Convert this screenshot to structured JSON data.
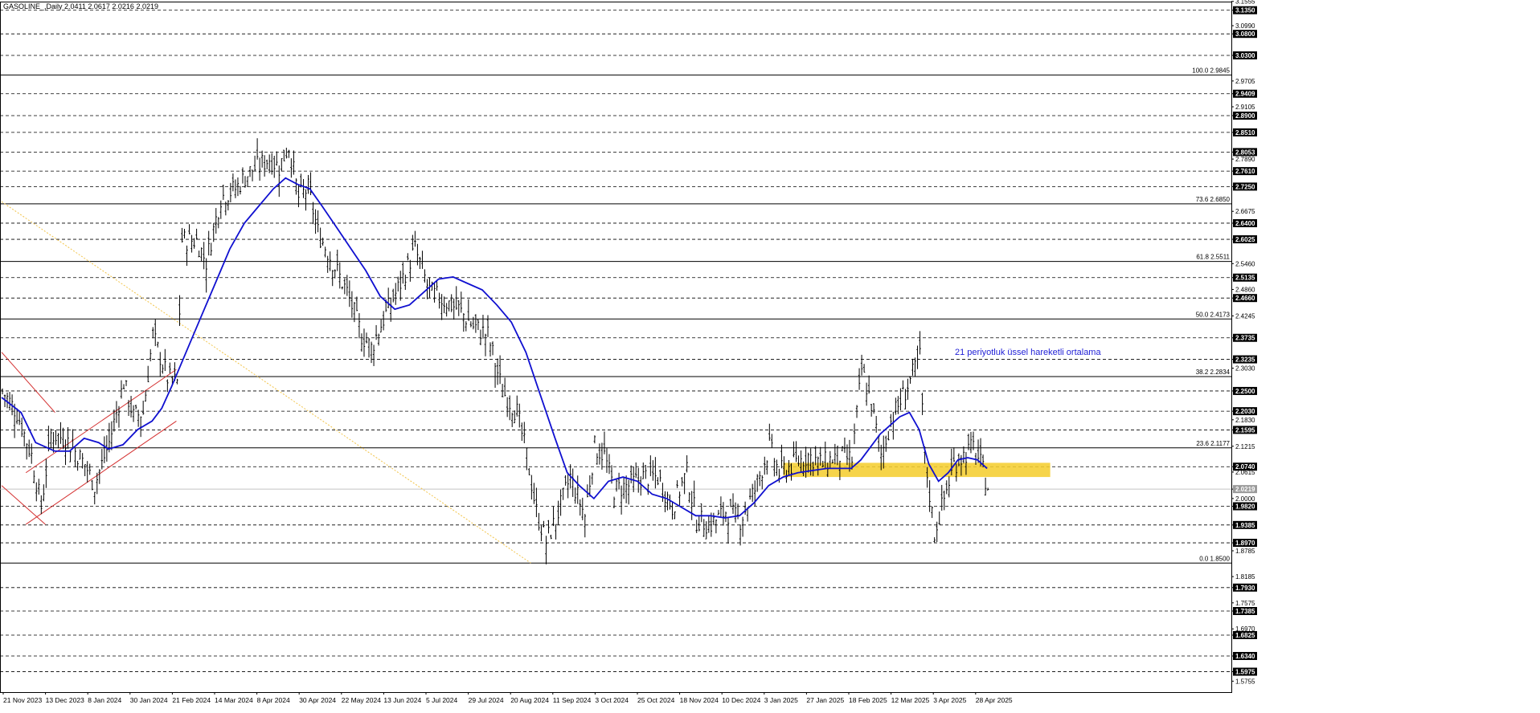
{
  "chart_data": {
    "type": "line",
    "title": "GASOLINE_,Daily  2.0411 2.0617 2.0216 2.0219",
    "ylim": [
      1.55,
      3.155
    ],
    "grid": true,
    "y_ticks": [
      {
        "v": 3.1555,
        "label": "3.1555",
        "box": false
      },
      {
        "v": 3.135,
        "label": "3.1350",
        "box": true
      },
      {
        "v": 3.099,
        "label": "3.0990",
        "box": false
      },
      {
        "v": 3.08,
        "label": "3.0800",
        "box": true
      },
      {
        "v": 3.03,
        "label": "3.0300",
        "box": true
      },
      {
        "v": 2.9705,
        "label": "2.9705",
        "box": false
      },
      {
        "v": 2.9409,
        "label": "2.9409",
        "box": true
      },
      {
        "v": 2.9105,
        "label": "2.9105",
        "box": false
      },
      {
        "v": 2.89,
        "label": "2.8900",
        "box": true
      },
      {
        "v": 2.851,
        "label": "2.8510",
        "box": true
      },
      {
        "v": 2.8053,
        "label": "2.8053",
        "box": true
      },
      {
        "v": 2.789,
        "label": "2.7890",
        "box": false
      },
      {
        "v": 2.761,
        "label": "2.7610",
        "box": true
      },
      {
        "v": 2.725,
        "label": "2.7250",
        "box": true
      },
      {
        "v": 2.6675,
        "label": "2.6675",
        "box": false
      },
      {
        "v": 2.64,
        "label": "2.6400",
        "box": true
      },
      {
        "v": 2.6025,
        "label": "2.6025",
        "box": true
      },
      {
        "v": 2.546,
        "label": "2.5460",
        "box": false
      },
      {
        "v": 2.5135,
        "label": "2.5135",
        "box": true
      },
      {
        "v": 2.486,
        "label": "2.4860",
        "box": false
      },
      {
        "v": 2.466,
        "label": "2.4660",
        "box": true
      },
      {
        "v": 2.4245,
        "label": "2.4245",
        "box": false
      },
      {
        "v": 2.3735,
        "label": "2.3735",
        "box": true
      },
      {
        "v": 2.3235,
        "label": "2.3235",
        "box": true
      },
      {
        "v": 2.303,
        "label": "2.3030",
        "box": false
      },
      {
        "v": 2.25,
        "label": "2.2500",
        "box": true
      },
      {
        "v": 2.203,
        "label": "2.2030",
        "box": true
      },
      {
        "v": 2.183,
        "label": "2.1830",
        "box": false
      },
      {
        "v": 2.1595,
        "label": "2.1595",
        "box": true
      },
      {
        "v": 2.1215,
        "label": "2.1215",
        "box": false
      },
      {
        "v": 2.074,
        "label": "2.0740",
        "box": true
      },
      {
        "v": 2.0615,
        "label": "2.0615",
        "box": false
      },
      {
        "v": 2.0219,
        "label": "2.0219",
        "box": "current"
      },
      {
        "v": 2.0,
        "label": "2.0000",
        "box": false
      },
      {
        "v": 1.982,
        "label": "1.9820",
        "box": true
      },
      {
        "v": 1.9385,
        "label": "1.9385",
        "box": true
      },
      {
        "v": 1.897,
        "label": "1.8970",
        "box": true
      },
      {
        "v": 1.8785,
        "label": "1.8785",
        "box": false
      },
      {
        "v": 1.8185,
        "label": "1.8185",
        "box": false
      },
      {
        "v": 1.793,
        "label": "1.7930",
        "box": true
      },
      {
        "v": 1.7575,
        "label": "1.7575",
        "box": false
      },
      {
        "v": 1.7385,
        "label": "1.7385",
        "box": true
      },
      {
        "v": 1.697,
        "label": "1.6970",
        "box": false
      },
      {
        "v": 1.6825,
        "label": "1.6825",
        "box": true
      },
      {
        "v": 1.634,
        "label": "1.6340",
        "box": true
      },
      {
        "v": 1.5975,
        "label": "1.5975",
        "box": true
      },
      {
        "v": 1.5755,
        "label": "1.5755",
        "box": false
      }
    ],
    "dashed_levels": [
      3.135,
      3.08,
      3.03,
      2.9409,
      2.89,
      2.851,
      2.8053,
      2.761,
      2.725,
      2.64,
      2.6025,
      2.5135,
      2.466,
      2.3735,
      2.3235,
      2.25,
      2.203,
      2.1595,
      2.074,
      1.982,
      1.9385,
      1.897,
      1.793,
      1.7385,
      1.6825,
      1.634,
      1.5975
    ],
    "fib_levels": [
      {
        "label": "100.0 2.9845",
        "v": 2.9845
      },
      {
        "label": "73.6 2.6850",
        "v": 2.685
      },
      {
        "label": "61.8 2.5511",
        "v": 2.5511
      },
      {
        "label": "50.0 2.4173",
        "v": 2.4173
      },
      {
        "label": "38.2 2.2834",
        "v": 2.2834
      },
      {
        "label": "23.6 2.1177",
        "v": 2.1177
      },
      {
        "label": "0.0 1.8500",
        "v": 1.85
      }
    ],
    "x_labels": [
      "21 Nov 2023",
      "13 Dec 2023",
      "8 Jan 2024",
      "30 Jan 2024",
      "21 Feb 2024",
      "14 Mar 2024",
      "8 Apr 2024",
      "30 Apr 2024",
      "22 May 2024",
      "13 Jun 2024",
      "5 Jul 2024",
      "29 Jul 2024",
      "20 Aug 2024",
      "11 Sep 2024",
      "3 Oct 2024",
      "25 Oct 2024",
      "18 Nov 2024",
      "10 Dec 2024",
      "3 Jan 2025",
      "27 Jan 2025",
      "18 Feb 2025",
      "12 Mar 2025",
      "3 Apr 2025",
      "28 Apr 2025"
    ],
    "series": [
      {
        "name": "21 periyotluk üssel hareketli ortalama",
        "color": "#1010d0",
        "x": [
          0,
          5,
          10,
          15,
          20,
          25,
          30,
          35,
          40,
          45,
          50,
          55,
          60,
          65,
          70,
          75,
          80,
          85,
          90,
          95,
          100,
          105,
          110,
          115,
          120,
          125,
          130,
          135,
          140,
          145,
          150,
          155,
          160,
          165,
          170,
          175,
          180,
          185,
          190,
          195,
          200,
          205,
          210,
          215,
          220,
          225,
          230,
          235,
          240,
          245,
          250,
          255,
          260,
          265,
          270,
          275,
          280,
          285,
          290,
          295,
          300,
          305,
          310,
          315,
          320,
          325,
          330,
          335,
          340,
          345,
          350,
          355,
          360,
          365,
          370,
          375,
          380,
          385,
          390,
          395,
          400,
          405,
          410,
          415,
          420,
          425,
          430,
          435,
          440,
          445,
          450,
          455,
          460,
          465,
          470,
          475,
          480,
          485,
          490,
          495,
          500,
          503
        ],
        "values": [
          2.23,
          2.22,
          2.2,
          2.17,
          2.12,
          2.1,
          2.1,
          2.14,
          2.13,
          2.11,
          2.13,
          2.17,
          2.18,
          2.22,
          2.27,
          2.35,
          2.45,
          2.53,
          2.6,
          2.66,
          2.69,
          2.72,
          2.74,
          2.73,
          2.72,
          2.68,
          2.62,
          2.58,
          2.55,
          2.52,
          2.48,
          2.44,
          2.45,
          2.48,
          2.51,
          2.52,
          2.52,
          2.5,
          2.46,
          2.42,
          2.38,
          2.3,
          2.21,
          2.12,
          2.06,
          2.03,
          2.02,
          2.0,
          2.02,
          2.06,
          2.06,
          2.04,
          2.02,
          2.0,
          1.99,
          1.98,
          1.96,
          1.95,
          1.96,
          1.95,
          1.95,
          1.98,
          2.02,
          2.05,
          2.06,
          2.06,
          2.07,
          2.07,
          2.07,
          2.08,
          2.1,
          2.13,
          2.16,
          2.19,
          2.2,
          2.14,
          2.06,
          2.03,
          2.06,
          2.09,
          2.1,
          2.09,
          2.07,
          2.06,
          2.05,
          2.05,
          2.05,
          2.04,
          2.04,
          2.04,
          2.04,
          2.04,
          2.04,
          2.04,
          2.04,
          2.04,
          2.04,
          2.04,
          2.04,
          2.04,
          2.04,
          2.04
        ]
      }
    ],
    "ema_curve": [
      [
        0,
        2.235
      ],
      [
        8,
        2.2
      ],
      [
        14,
        2.13
      ],
      [
        22,
        2.11
      ],
      [
        28,
        2.11
      ],
      [
        34,
        2.14
      ],
      [
        40,
        2.13
      ],
      [
        44,
        2.115
      ],
      [
        50,
        2.125
      ],
      [
        56,
        2.16
      ],
      [
        62,
        2.18
      ],
      [
        66,
        2.21
      ],
      [
        70,
        2.26
      ],
      [
        76,
        2.34
      ],
      [
        82,
        2.42
      ],
      [
        88,
        2.5
      ],
      [
        94,
        2.58
      ],
      [
        100,
        2.64
      ],
      [
        106,
        2.68
      ],
      [
        112,
        2.72
      ],
      [
        117,
        2.745
      ],
      [
        122,
        2.73
      ],
      [
        127,
        2.72
      ],
      [
        132,
        2.68
      ],
      [
        138,
        2.63
      ],
      [
        144,
        2.58
      ],
      [
        150,
        2.53
      ],
      [
        156,
        2.47
      ],
      [
        162,
        2.44
      ],
      [
        168,
        2.45
      ],
      [
        174,
        2.48
      ],
      [
        180,
        2.51
      ],
      [
        186,
        2.515
      ],
      [
        192,
        2.5
      ],
      [
        198,
        2.485
      ],
      [
        204,
        2.45
      ],
      [
        210,
        2.41
      ],
      [
        216,
        2.34
      ],
      [
        222,
        2.24
      ],
      [
        228,
        2.14
      ],
      [
        233,
        2.06
      ],
      [
        238,
        2.03
      ],
      [
        244,
        2.0
      ],
      [
        250,
        2.04
      ],
      [
        256,
        2.05
      ],
      [
        262,
        2.04
      ],
      [
        268,
        2.01
      ],
      [
        274,
        2.0
      ],
      [
        280,
        1.98
      ],
      [
        286,
        1.96
      ],
      [
        292,
        1.96
      ],
      [
        298,
        1.955
      ],
      [
        304,
        1.96
      ],
      [
        310,
        1.99
      ],
      [
        316,
        2.03
      ],
      [
        322,
        2.05
      ],
      [
        328,
        2.06
      ],
      [
        334,
        2.065
      ],
      [
        340,
        2.07
      ],
      [
        346,
        2.07
      ],
      [
        350,
        2.07
      ],
      [
        354,
        2.09
      ],
      [
        358,
        2.12
      ],
      [
        362,
        2.15
      ],
      [
        366,
        2.17
      ],
      [
        370,
        2.19
      ],
      [
        374,
        2.2
      ],
      [
        378,
        2.16
      ],
      [
        382,
        2.08
      ],
      [
        386,
        2.04
      ],
      [
        390,
        2.06
      ],
      [
        394,
        2.09
      ],
      [
        398,
        2.095
      ],
      [
        402,
        2.09
      ],
      [
        406,
        2.07
      ]
    ],
    "channel_lines": [
      {
        "color": "#d43030",
        "x1": 10,
        "y1": 2.06,
        "x2": 72,
        "y2": 2.3
      },
      {
        "color": "#d43030",
        "x1": 10,
        "y1": 1.94,
        "x2": 72,
        "y2": 2.18
      },
      {
        "color": "#d43030",
        "x1": 0,
        "y1": 2.34,
        "x2": 22,
        "y2": 2.2
      },
      {
        "color": "#d43030",
        "x1": 0,
        "y1": 2.03,
        "x2": 18,
        "y2": 1.94
      }
    ],
    "trend_line": {
      "color": "#f2c44a",
      "x1": 0,
      "y1": 2.69,
      "x2": 218,
      "y2": 1.85
    },
    "zone": {
      "color": "#f5cc2a",
      "x1": 322,
      "x2": 432,
      "y1": 2.05,
      "y2": 2.083
    },
    "annotation": "21 periyotluk üssel hareketli ortalama",
    "current_price": 2.0219,
    "last_bar": {
      "open": 2.0411,
      "high": 2.0617,
      "low": 2.0216,
      "close": 2.0219
    }
  }
}
